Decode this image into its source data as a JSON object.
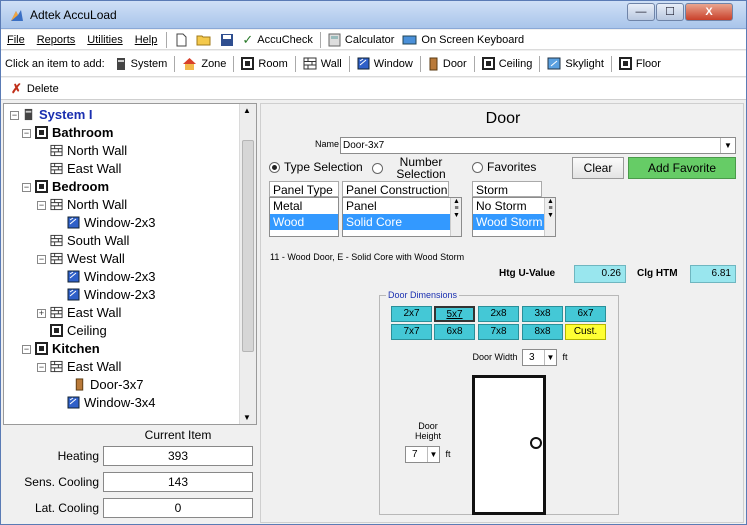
{
  "window": {
    "title": "Adtek AccuLoad",
    "min_label": "—",
    "max_label": "☐",
    "close_label": "X"
  },
  "menu": {
    "items": [
      {
        "label": "File",
        "key": "F"
      },
      {
        "label": "Reports",
        "key": "R"
      },
      {
        "label": "Utilities",
        "key": "U"
      },
      {
        "label": "Help",
        "key": "H"
      }
    ],
    "accucheck": "AccuCheck",
    "calculator": "Calculator",
    "keyboard": "On Screen Keyboard"
  },
  "addbar": {
    "prompt": "Click an item to add:",
    "items": [
      "System",
      "Zone",
      "Room",
      "Wall",
      "Window",
      "Door",
      "Ceiling",
      "Skylight",
      "Floor"
    ]
  },
  "delbar": {
    "delete_label": "Delete"
  },
  "tree": {
    "nodes": [
      {
        "label": "System I",
        "type": "system"
      },
      {
        "label": "Bathroom",
        "type": "room"
      },
      {
        "label": "North Wall",
        "type": "wall"
      },
      {
        "label": "East Wall",
        "type": "wall"
      },
      {
        "label": "Bedroom",
        "type": "room"
      },
      {
        "label": "North Wall",
        "type": "wall"
      },
      {
        "label": "Window-2x3",
        "type": "window"
      },
      {
        "label": "South Wall",
        "type": "wall"
      },
      {
        "label": "West Wall",
        "type": "wall"
      },
      {
        "label": "Window-2x3",
        "type": "window"
      },
      {
        "label": "Window-2x3",
        "type": "window"
      },
      {
        "label": "East Wall",
        "type": "wall"
      },
      {
        "label": "Ceiling",
        "type": "ceiling"
      },
      {
        "label": "Kitchen",
        "type": "room"
      },
      {
        "label": "East Wall",
        "type": "wall"
      },
      {
        "label": "Door-3x7",
        "type": "door"
      },
      {
        "label": "Window-3x4",
        "type": "window"
      }
    ]
  },
  "current_item": {
    "header": "Current Item",
    "rows": [
      {
        "label": "Heating",
        "value": "393"
      },
      {
        "label": "Sens. Cooling",
        "value": "143"
      },
      {
        "label": "Lat. Cooling",
        "value": "0"
      }
    ]
  },
  "door": {
    "title": "Door",
    "name_label": "Name",
    "name_value": "Door-3x7",
    "type_selection": "Type Selection",
    "number_selection": "Number Selection",
    "favorites": "Favorites",
    "clear": "Clear",
    "add_favorite": "Add Favorite",
    "panel_type_header": "Panel Type",
    "panel_types": [
      "Metal",
      "Wood"
    ],
    "panel_construction_header": "Panel Construction",
    "panel_constructions": [
      "Panel",
      "Solid Core"
    ],
    "storm_header": "Storm",
    "storms": [
      "No Storm",
      "Wood Storm"
    ],
    "description": "11 - Wood Door, E - Solid Core with Wood Storm",
    "htg_label": "Htg U-Value",
    "htg_value": "0.26",
    "clg_label": "Clg HTM",
    "clg_value": "6.81",
    "dimensions_legend": "Door Dimensions",
    "dimension_buttons": [
      "2x7",
      "5x7",
      "2x8",
      "3x8",
      "6x7",
      "7x7",
      "6x8",
      "7x8",
      "8x8",
      "Cust."
    ],
    "door_width_label": "Door Width",
    "door_width_value": "3",
    "door_height_label": "Door Height",
    "door_height_value": "7",
    "unit": "ft"
  },
  "colors": {
    "cyan_button": "#44c8d6",
    "yellow_button": "#ffff33",
    "green_button": "#66cc66",
    "selection": "#3399ff",
    "value_box": "#99e6ee"
  }
}
